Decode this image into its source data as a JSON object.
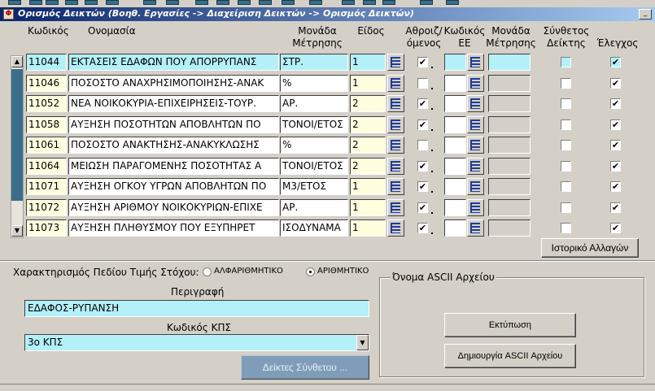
{
  "window": {
    "title": "Ορισμός Δεικτών (Βοηθ. Εργασίες -> Διαχείριση Δεικτών -> Ορισμός Δεικτών)",
    "minimize_label": "_"
  },
  "grid": {
    "headers": {
      "code": "Κωδικός",
      "name": "Ονομασία",
      "unit": "Μονάδα Μέτρησης",
      "type": "Είδος",
      "aggregated": "Αθροιζ/ όμενος",
      "ee_code": "Κωδικός ΕΕ",
      "ee_unit": "Μονάδα Μέτρησης",
      "composite": "Σύνθετος Δείκτης",
      "check": "Έλεγχος"
    },
    "rows": [
      {
        "code": "11044",
        "name": "ΕΚΤΑΣΕΙΣ ΕΔΑΦΩΝ ΠΟΥ ΑΠΟΡΡΥΠΑΝΣ",
        "unit": "ΣΤΡ.",
        "type": "1",
        "aggregated": "✔",
        "composite": "",
        "check": "✔"
      },
      {
        "code": "11046",
        "name": "ΠΟΣΟΣΤΟ ΑΝΑΧΡΗΣΙΜΟΠΟΙΗΣΗΣ-ΑΝΑΚ",
        "unit": "%",
        "type": "1",
        "aggregated": "",
        "composite": "",
        "check": "✔"
      },
      {
        "code": "11052",
        "name": "ΝΕΑ  ΝΟΙΚΟΚΥΡΙΑ-ΕΠΙΧΕΙΡΗΣΕΙΣ-ΤΟΥΡ.",
        "unit": "ΑΡ.",
        "type": "2",
        "aggregated": "✔",
        "composite": "",
        "check": "✔"
      },
      {
        "code": "11058",
        "name": "ΑΥΞΗΣΗ ΠΟΣΟΤΗΤΩΝ  ΑΠΟΒΛΗΤΩΝ ΠΟ",
        "unit": "ΤΟΝΟΙ/ΕΤΟΣ",
        "type": "2",
        "aggregated": "✔",
        "composite": "",
        "check": "✔"
      },
      {
        "code": "11061",
        "name": "ΠΟΣΟΣΤΟ ΑΝΑΚΤΗΣΗΣ-ΑΝΑΚΥΚΛΩΣΗΣ",
        "unit": "%",
        "type": "2",
        "aggregated": "",
        "composite": "",
        "check": "✔"
      },
      {
        "code": "11064",
        "name": "ΜΕΙΩΣΗ ΠΑΡΑΓΟΜΕΝΗΣ ΠΟΣΟΤΗΤΑΣ Α",
        "unit": "ΤΟΝΟΙ/ΕΤΟΣ",
        "type": "2",
        "aggregated": "✔",
        "composite": "",
        "check": "✔"
      },
      {
        "code": "11071",
        "name": "ΑΥΞΗΣΗ ΟΓΚΟΥ ΥΓΡΩΝ ΑΠΟΒΛΗΤΩΝ ΠΟ",
        "unit": "Μ3/ΕΤΟΣ",
        "type": "1",
        "aggregated": "✔",
        "composite": "",
        "check": "✔"
      },
      {
        "code": "11072",
        "name": "ΑΥΞΗΣΗ  ΑΡΙΘΜΟΥ ΝΟΙΚΟΚΥΡΙΩΝ-ΕΠΙΧΕ",
        "unit": "ΑΡ.",
        "type": "1",
        "aggregated": "✔",
        "composite": "",
        "check": "✔"
      },
      {
        "code": "11073",
        "name": "ΑΥΞΗΣΗ ΠΛΗΘΥΣΜΟΥ ΠΟΥ ΕΞΥΠΗΡΕΤ",
        "unit": "ΙΣΟΔΥΝΑΜΑ",
        "type": "1",
        "aggregated": "✔",
        "composite": "",
        "check": "✔"
      }
    ]
  },
  "history_button": "Ιστορικό Αλλαγών",
  "target_field": {
    "label": "Χαρακτηρισμός Πεδίου Τιμής Στόχου:",
    "option_alpha": "ΑΛΦΑΡΙΘΜΗΤΙΚΟ",
    "option_numeric": "ΑΡΙΘΜΗΤΙΚΟ",
    "selected": "ΑΡΙΘΜΗΤΙΚΟ"
  },
  "description": {
    "label": "Περιγραφή",
    "value": "ΕΔΑΦΟΣ-ΡΥΠΑΝΣΗ"
  },
  "kps": {
    "label": "Κωδικός ΚΠΣ",
    "value": "3ο ΚΠΣ"
  },
  "composite_button": "Δείκτες Σύνθετου ...",
  "ascii_group": {
    "title": "Όνομα ASCII Αρχείου",
    "print_button": "Εκτύπωση",
    "create_button": "Δημιουργία ASCII Αρχείου"
  },
  "colors": {
    "title_start": "#0a246a",
    "title_end": "#a6caf0",
    "field_yellow": "#ffffe0",
    "field_cyan": "#b4f0f8",
    "composite_btn": "#7f9db9"
  }
}
